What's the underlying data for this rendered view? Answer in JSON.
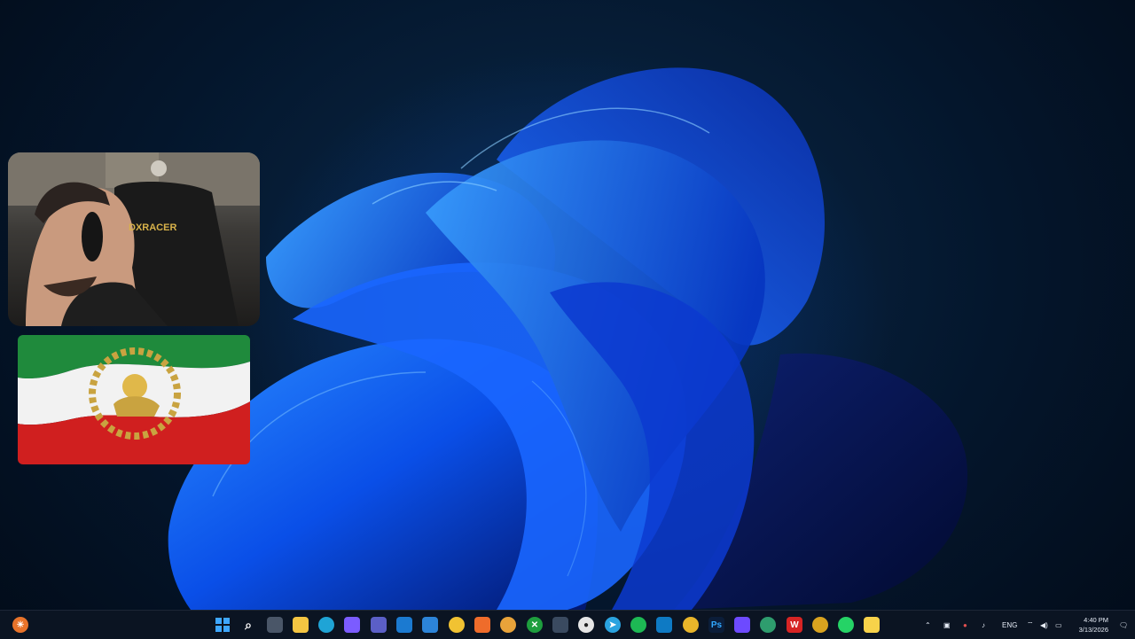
{
  "taskbar": {
    "language": "ENG",
    "time": "4:40 PM",
    "date": "3/13/2026",
    "pinned_icons": [
      "start-icon",
      "search-icon",
      "task-view-icon",
      "file-explorer-icon",
      "edge-icon",
      "copilot-icon",
      "teams-icon",
      "outlook-icon",
      "mail-icon",
      "chrome-icon",
      "brave-icon",
      "chrome-canary-icon",
      "xbox-icon",
      "media-player-icon",
      "obs-icon",
      "telegram-icon",
      "spotify-icon",
      "vscode-icon",
      "chrome-icon",
      "photoshop-icon",
      "proton-icon",
      "edge-dev-icon",
      "wps-icon",
      "chrome-icon",
      "whatsapp-icon",
      "sticky-notes-icon"
    ]
  },
  "overlays": {
    "webcam_chair_brand": "DXRACER",
    "flag": "lion-and-sun-flag"
  }
}
